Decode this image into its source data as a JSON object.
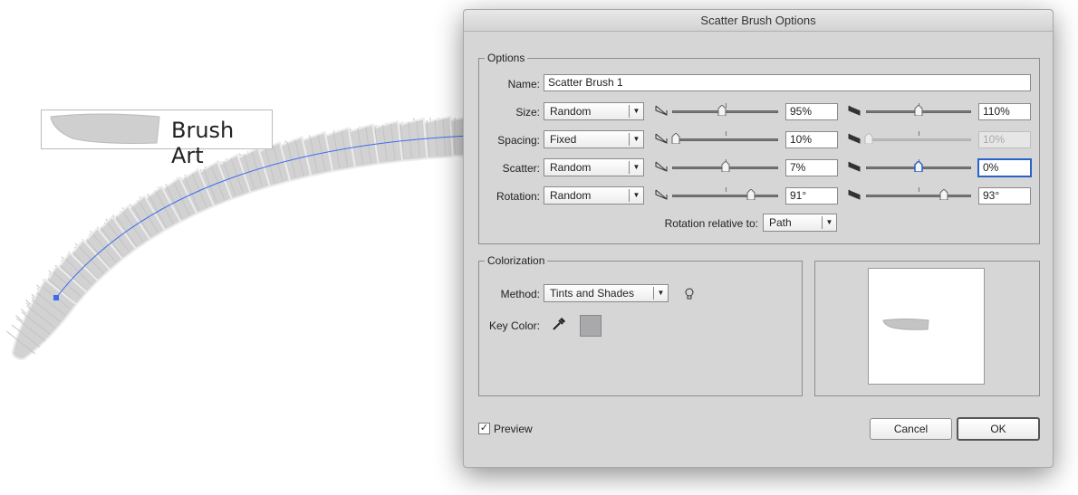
{
  "canvas": {
    "brush_art_label": "Brush Art",
    "path_color": "#3b6cf0"
  },
  "dialog": {
    "title": "Scatter Brush Options",
    "options": {
      "legend": "Options",
      "name_label": "Name:",
      "name_value": "Scatter Brush 1",
      "rows": [
        {
          "label": "Size:",
          "mode": "Random",
          "min_pct": 0.47,
          "min_value": "95%",
          "max_pct": 0.5,
          "max_value": "110%",
          "max_disabled": false,
          "max_focused": false
        },
        {
          "label": "Spacing:",
          "mode": "Fixed",
          "min_pct": 0.03,
          "min_value": "10%",
          "max_pct": 0.03,
          "max_value": "10%",
          "max_disabled": true,
          "max_focused": false
        },
        {
          "label": "Scatter:",
          "mode": "Random",
          "min_pct": 0.5,
          "min_value": "7%",
          "max_pct": 0.5,
          "max_value": "0%",
          "max_disabled": false,
          "max_focused": true
        },
        {
          "label": "Rotation:",
          "mode": "Random",
          "min_pct": 0.74,
          "min_value": "91°",
          "max_pct": 0.74,
          "max_value": "93°",
          "max_disabled": false,
          "max_focused": false
        }
      ],
      "rotation_relative_label": "Rotation relative to:",
      "rotation_relative_value": "Path"
    },
    "colorization": {
      "legend": "Colorization",
      "method_label": "Method:",
      "method_value": "Tints and Shades",
      "key_color_label": "Key Color:",
      "key_color": "#a9a9ab"
    },
    "preview_label": "Preview",
    "preview_checked": true,
    "cancel_label": "Cancel",
    "ok_label": "OK"
  }
}
